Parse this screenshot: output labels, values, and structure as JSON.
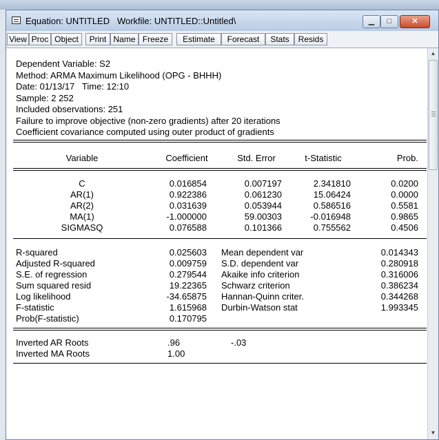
{
  "window": {
    "title": "Equation: UNTITLED   Workfile: UNTITLED::Untitled\\",
    "min_icon": "minimize-icon",
    "max_icon": "maximize-icon",
    "close_icon": "close-icon"
  },
  "toolbar": {
    "view": "View",
    "proc": "Proc",
    "object": "Object",
    "print": "Print",
    "name": "Name",
    "freeze": "Freeze",
    "estimate": "Estimate",
    "forecast": "Forecast",
    "stats": "Stats",
    "resids": "Resids"
  },
  "header": {
    "line1": "Dependent Variable: S2",
    "line2": "Method: ARMA Maximum Likelihood (OPG - BHHH)",
    "line3": "Date: 01/13/17   Time: 12:10",
    "line4": "Sample: 2 252",
    "line5": "Included observations: 251",
    "line6": "Failure to improve objective (non-zero gradients) after 20 iterations",
    "line7": "Coefficient covariance computed using outer product of gradients"
  },
  "coef_table": {
    "columns": [
      "Variable",
      "Coefficient",
      "Std. Error",
      "t-Statistic",
      "Prob."
    ],
    "rows": [
      [
        "C",
        "0.016854",
        "0.007197",
        "2.341810",
        "0.0200"
      ],
      [
        "AR(1)",
        "0.922386",
        "0.061230",
        "15.06424",
        "0.0000"
      ],
      [
        "AR(2)",
        "0.031639",
        "0.053944",
        "0.586516",
        "0.5581"
      ],
      [
        "MA(1)",
        "-1.000000",
        "59.00303",
        "-0.016948",
        "0.9865"
      ],
      [
        "SIGMASQ",
        "0.076588",
        "0.101366",
        "0.755562",
        "0.4506"
      ]
    ]
  },
  "stats": {
    "rows": [
      [
        "R-squared",
        "0.025603",
        "Mean dependent var",
        "0.014343"
      ],
      [
        "Adjusted R-squared",
        "0.009759",
        "S.D. dependent var",
        "0.280918"
      ],
      [
        "S.E. of regression",
        "0.279544",
        "Akaike info criterion",
        "0.316006"
      ],
      [
        "Sum squared resid",
        "19.22365",
        "Schwarz criterion",
        "0.386234"
      ],
      [
        "Log likelihood",
        "-34.65875",
        "Hannan-Quinn criter.",
        "0.344268"
      ],
      [
        "F-statistic",
        "1.615968",
        "Durbin-Watson stat",
        "1.993345"
      ],
      [
        "Prob(F-statistic)",
        "0.170795",
        "",
        ""
      ]
    ]
  },
  "roots": {
    "ar_label": "Inverted AR Roots",
    "ar_val1": ".96",
    "ar_val2": "-.03",
    "ma_label": "Inverted MA Roots",
    "ma_val1": "1.00"
  },
  "colors": {
    "close_button": "#c94a2b",
    "titlebar": "#c9d9ed",
    "content_bg": "#ffffff"
  }
}
